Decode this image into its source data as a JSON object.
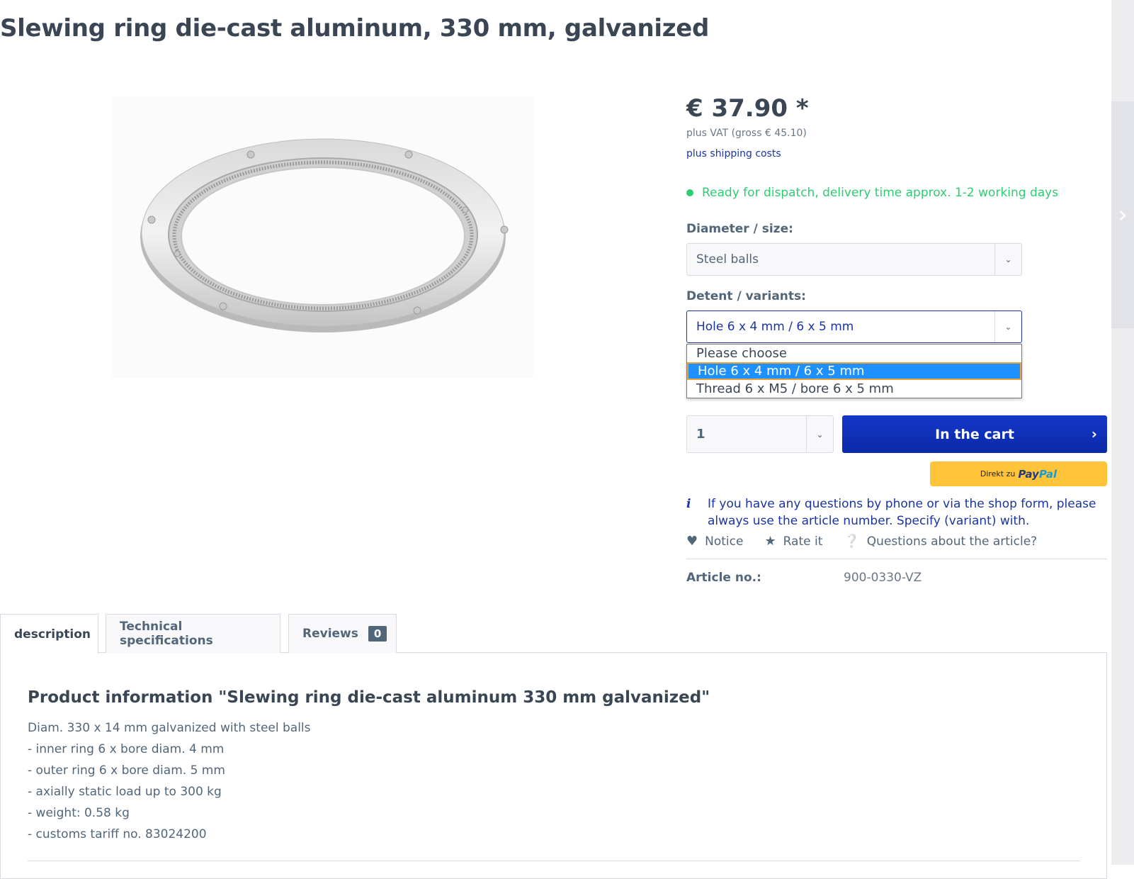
{
  "product": {
    "title": "Slewing ring die-cast aluminum, 330 mm, galvanized",
    "price": "€ 37.90 *",
    "vat": "plus VAT (gross € 45.10)",
    "shipping": "plus shipping costs",
    "availability": "Ready for dispatch, delivery time approx. 1-2 working days"
  },
  "config": {
    "diameter_label": "Diameter / size:",
    "diameter_value": "Steel balls",
    "detent_label": "Detent / variants:",
    "detent_value": "Hole 6 x 4 mm / 6 x 5 mm",
    "detent_options": [
      "Please choose",
      "Hole 6 x 4 mm / 6 x 5 mm",
      "Thread 6 x M5 / bore 6 x 5 mm"
    ]
  },
  "buy": {
    "quantity": "1",
    "cart_label": "In the cart",
    "paypal_prefix": "Direkt zu",
    "paypal_brand_a": "Pay",
    "paypal_brand_b": "Pal"
  },
  "info": {
    "text": "If you have any questions by phone or via the shop form, please always use the article number. Specify (variant) with.",
    "actions": {
      "notice": "Notice",
      "rate": "Rate it",
      "questions": "Questions about the article?"
    },
    "article_label": "Article no.:",
    "article_value": "900-0330-VZ"
  },
  "tabs": {
    "description": "description",
    "tech": "Technical specifications",
    "reviews": "Reviews",
    "reviews_count": "0"
  },
  "description": {
    "title": "Product information \"Slewing ring die-cast aluminum 330 mm galvanized\"",
    "lines": [
      "Diam. 330 x 14 mm galvanized with steel balls",
      "- inner ring 6 x bore diam. 4 mm",
      "- outer ring 6 x bore diam. 5 mm",
      "- axially static load up to 300 kg",
      "- weight: 0.58 kg",
      "- customs tariff no. 83024200"
    ]
  },
  "colors": {
    "accent_blue": "#1a35a0",
    "cart_button": "#0a2aa8",
    "available_green": "#2ecc71",
    "paypal_yellow": "#ffc439",
    "selected_option": "#1e90ff"
  }
}
